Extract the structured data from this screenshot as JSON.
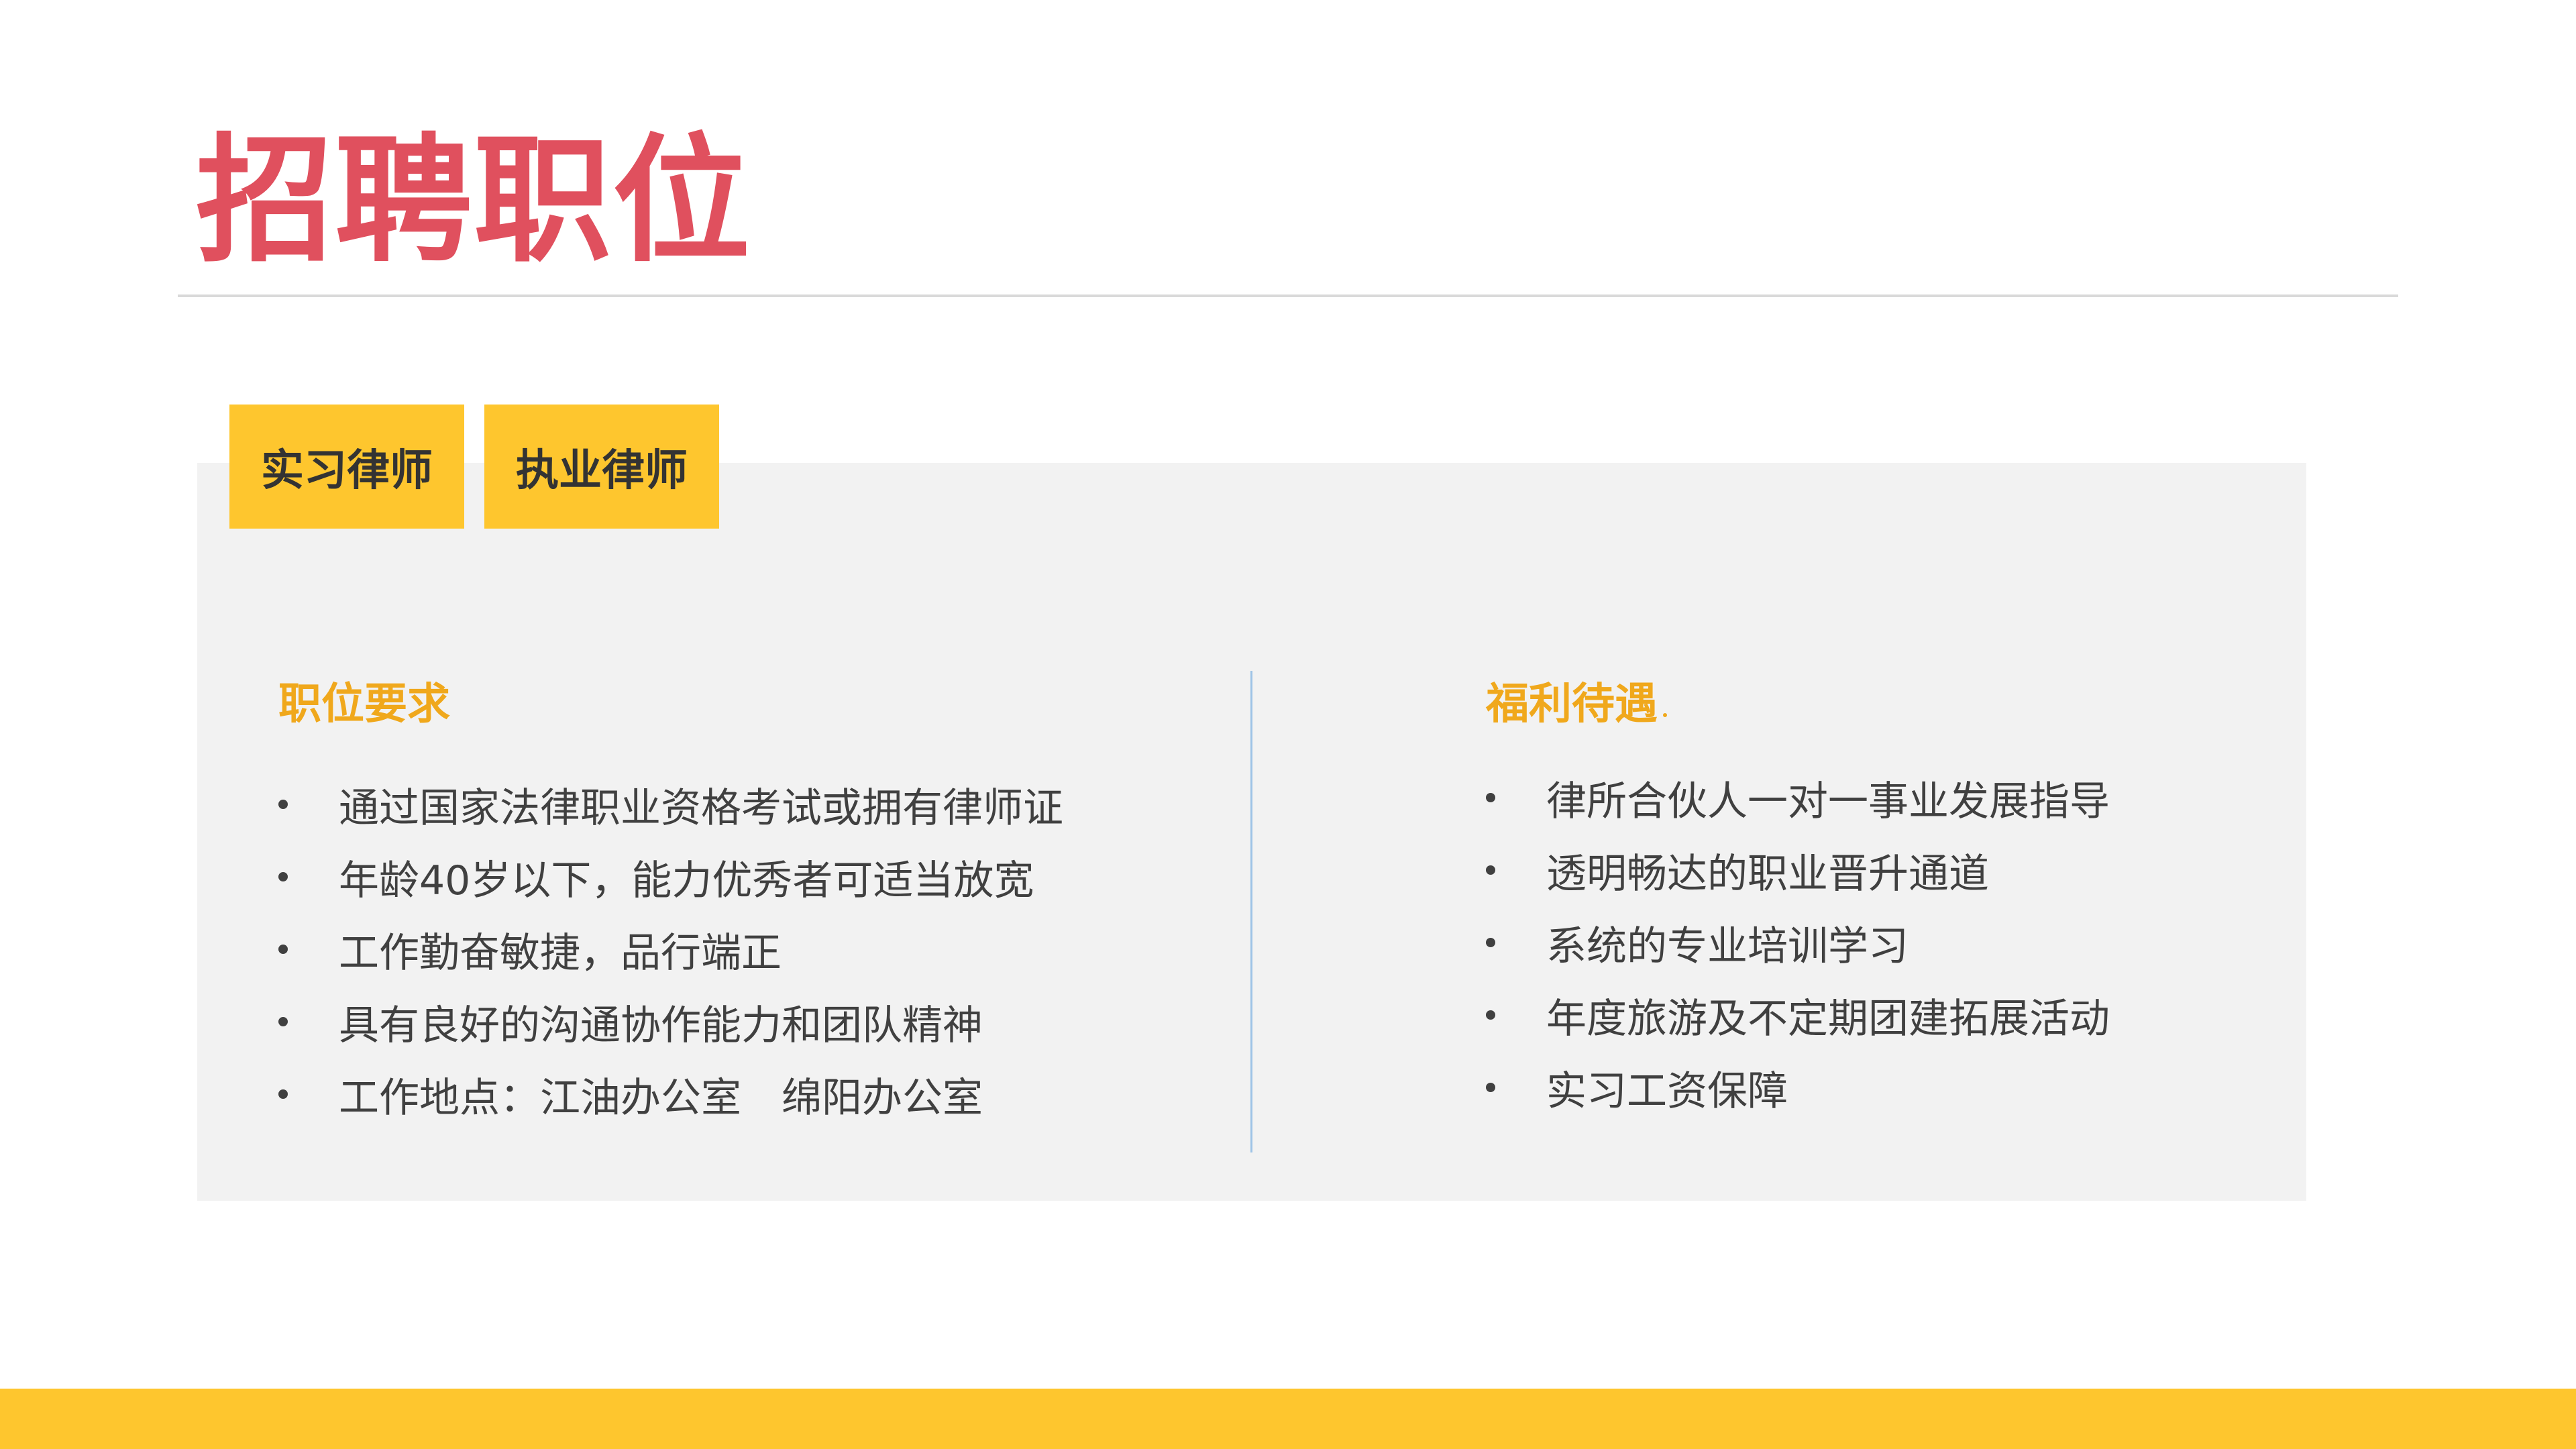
{
  "title": "招聘职位",
  "tabs": [
    {
      "label": "实习律师"
    },
    {
      "label": "执业律师"
    }
  ],
  "requirements": {
    "heading": "职位要求",
    "items": [
      "通过国家法律职业资格考试或拥有律师证",
      "年龄40岁以下，能力优秀者可适当放宽",
      "工作勤奋敏捷，品行端正",
      "具有良好的沟通协作能力和团队精神",
      "工作地点：江油办公室　绵阳办公室"
    ]
  },
  "benefits": {
    "heading": "福利待遇",
    "items": [
      "律所合伙人一对一事业发展指导",
      "透明畅达的职业晋升通道",
      "系统的专业培训学习",
      "年度旅游及不定期团建拓展活动",
      "实习工资保障"
    ]
  },
  "colors": {
    "title": "#e0505e",
    "accent_yellow": "#fec62e",
    "heading_orange": "#f0a81c",
    "panel_gray": "#f2f2f2",
    "divider_blue": "#9dc3e6",
    "text": "#404040"
  }
}
